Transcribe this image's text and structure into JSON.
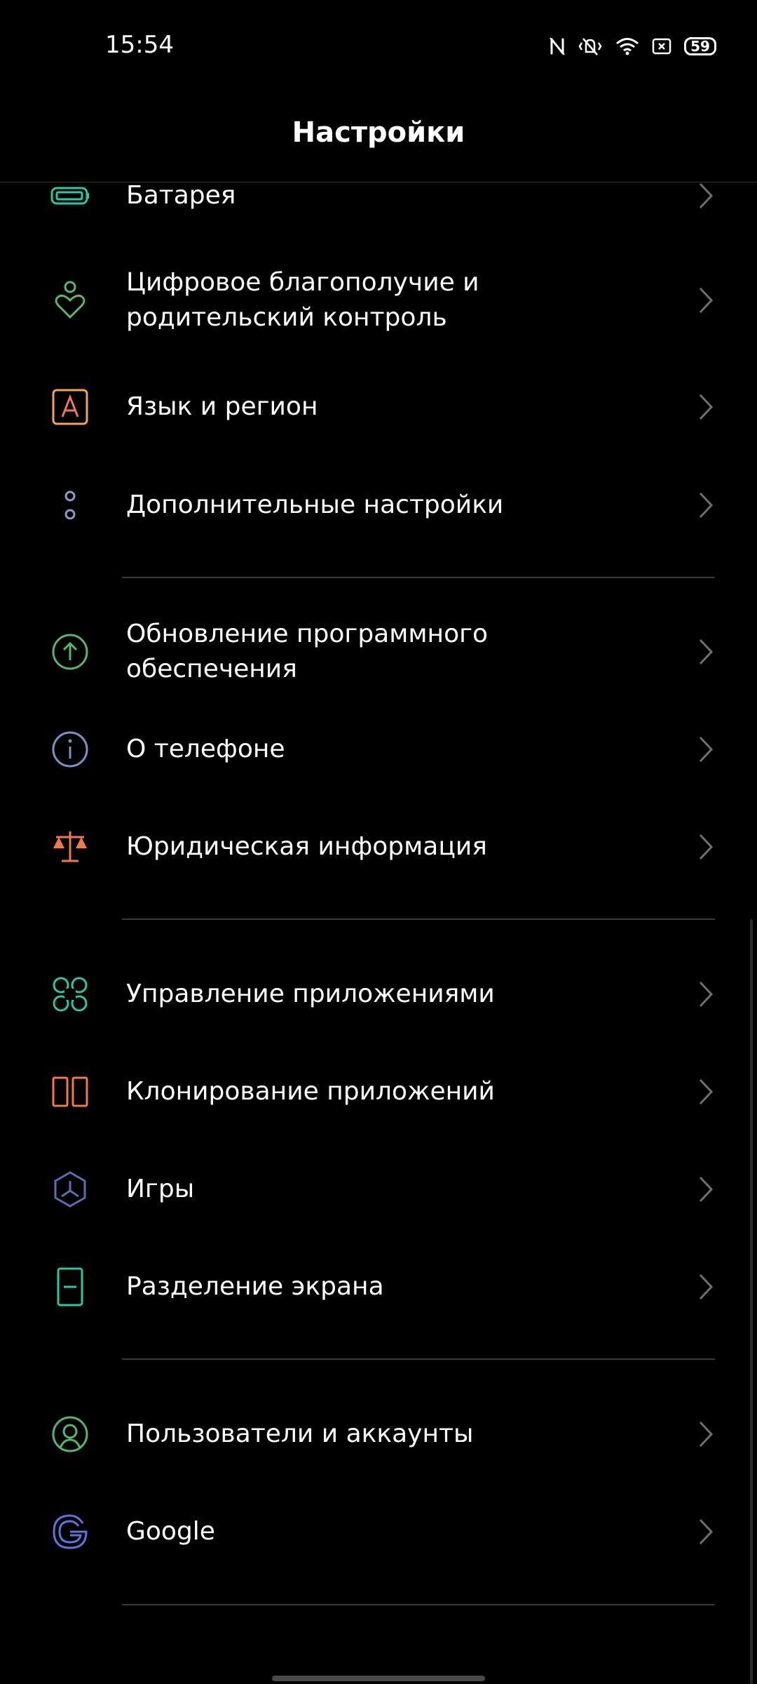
{
  "status_bar": {
    "time": "15:54",
    "battery_level": "59",
    "icons": [
      "nfc-icon",
      "vibrate-silent-icon",
      "wifi-icon",
      "screenshot-icon",
      "battery-icon"
    ]
  },
  "header": {
    "title": "Настройки"
  },
  "items": [
    {
      "label": "Батарея",
      "icon": "battery-icon",
      "color": "#2ec4a6"
    },
    {
      "label": "Цифровое благополучие и родительский контроль",
      "icon": "wellbeing-icon",
      "color": "#5ab56e"
    },
    {
      "label": "Язык и регион",
      "icon": "language-icon",
      "color": "#f0a35a"
    },
    {
      "label": "Дополнительные настройки",
      "icon": "more-settings-icon",
      "color": "#8f98c8"
    },
    {
      "label": "Обновление программного обеспечения",
      "icon": "software-update-icon",
      "color": "#58b66a"
    },
    {
      "label": "О телефоне",
      "icon": "info-icon",
      "color": "#7f8fc8"
    },
    {
      "label": "Юридическая информация",
      "icon": "scales-icon",
      "color": "#f07a4a"
    },
    {
      "label": "Управление приложениями",
      "icon": "app-management-icon",
      "color": "#2ec4a6"
    },
    {
      "label": "Клонирование приложений",
      "icon": "app-clone-icon",
      "color": "#f07a4a"
    },
    {
      "label": "Игры",
      "icon": "games-icon",
      "color": "#5a6fb0"
    },
    {
      "label": "Разделение экрана",
      "icon": "split-screen-icon",
      "color": "#2ec4a6"
    },
    {
      "label": "Пользователи и аккаунты",
      "icon": "users-icon",
      "color": "#58b66a"
    },
    {
      "label": "Google",
      "icon": "google-icon",
      "color": "#5b76d9"
    }
  ]
}
